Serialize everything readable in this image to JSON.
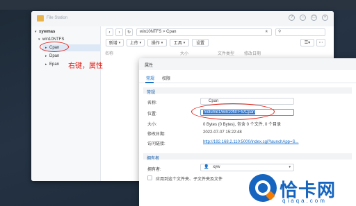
{
  "app": {
    "title": "File Station"
  },
  "window_controls": [
    "?",
    "–",
    "□",
    "×"
  ],
  "sidebar": {
    "host": "xywmas",
    "share": "win10NTFS",
    "items": [
      "Cpan",
      "Dpan",
      "Epan"
    ]
  },
  "toolbar": {
    "path": "win10NTFS > Cpan",
    "search_placeholder": "",
    "buttons": [
      "新增",
      "上传",
      "操作",
      "工具",
      "设置"
    ]
  },
  "file_list": {
    "columns": [
      "名称",
      "大小",
      "文件类型",
      "修改日期"
    ]
  },
  "annotation": {
    "text": "右键，属性",
    "color": "#e3231a"
  },
  "properties": {
    "title": "属性",
    "tabs": [
      "常规",
      "权限"
    ],
    "general_section": "常规",
    "fields": {
      "name_label": "名称:",
      "name_value": "Cpan",
      "location_label": "位置:",
      "location_value": "/volume1/win10NTFS/Cpan",
      "size_label": "大小:",
      "size_value": "0 Bytes (0 Bytes), 包含 0 个文件, 0 个目录",
      "modified_label": "修改日期:",
      "modified_value": "2022-07-07 15:22:48",
      "link_label": "访问链接:",
      "link_value": "http://192.168.2.110:5000/index.cgi?launchApp=S..."
    },
    "owner_section": "拥有者",
    "owner_label": "拥有者:",
    "owner_value": "xyw",
    "apply_label": "应用到这个文件夹、子文件夹及文件"
  },
  "watermark": {
    "text": "恰卡网",
    "url": "qiaqa.com"
  },
  "colors": {
    "accent": "#1a6fc7",
    "annotation_red": "#e3231a",
    "selection": "#dce8f6"
  }
}
